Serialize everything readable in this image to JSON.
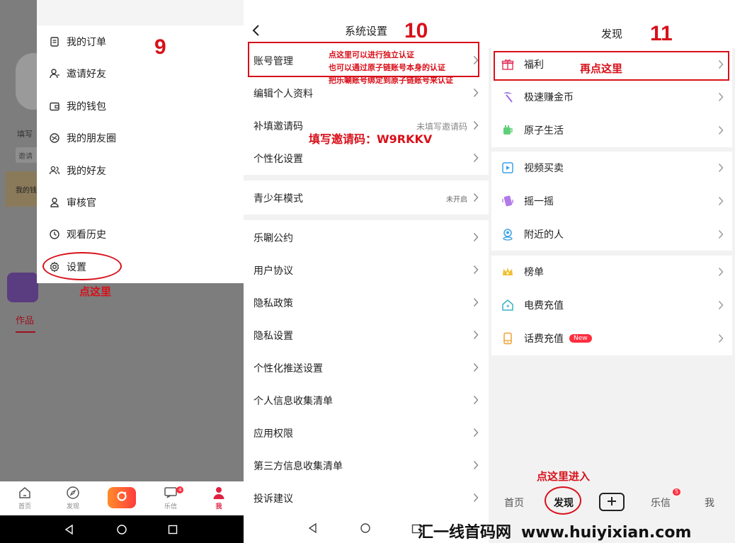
{
  "panel1": {
    "background": {
      "fill_label": "填写",
      "tag_label": "邀请",
      "wallet_label": "我的钱",
      "tab_label": "作品"
    },
    "menu": [
      {
        "label": "我的订单",
        "icon": "order-icon"
      },
      {
        "label": "邀请好友",
        "icon": "invite-user-icon"
      },
      {
        "label": "我的钱包",
        "icon": "wallet-icon"
      },
      {
        "label": "我的朋友圈",
        "icon": "moments-icon"
      },
      {
        "label": "我的好友",
        "icon": "friends-icon"
      },
      {
        "label": "审核官",
        "icon": "reviewer-icon"
      },
      {
        "label": "观看历史",
        "icon": "history-icon"
      },
      {
        "label": "设置",
        "icon": "gear-icon"
      }
    ],
    "tabbar": [
      {
        "label": "首页",
        "icon": "home-icon"
      },
      {
        "label": "发现",
        "icon": "compass-icon"
      },
      {
        "label": "",
        "icon": "camera-icon"
      },
      {
        "label": "乐信",
        "icon": "message-icon",
        "badge": "4"
      },
      {
        "label": "我",
        "icon": "user-icon"
      }
    ],
    "annotation_step": "9",
    "annotation_text": "点这里"
  },
  "panel2": {
    "title": "系统设置",
    "rows": [
      {
        "label": "账号管理",
        "right": ""
      },
      {
        "label": "编辑个人资料",
        "right": ""
      },
      {
        "label": "补填邀请码",
        "right": "未填写邀请码"
      },
      {
        "label": "个性化设置",
        "right": ""
      },
      {
        "label": "青少年模式",
        "right": "未开启"
      },
      {
        "label": "乐唰公约",
        "right": ""
      },
      {
        "label": "用户协议",
        "right": ""
      },
      {
        "label": "隐私政策",
        "right": ""
      },
      {
        "label": "隐私设置",
        "right": ""
      },
      {
        "label": "个性化推送设置",
        "right": ""
      },
      {
        "label": "个人信息收集清单",
        "right": ""
      },
      {
        "label": "应用权限",
        "right": ""
      },
      {
        "label": "第三方信息收集清单",
        "right": ""
      },
      {
        "label": "投诉建议",
        "right": ""
      }
    ],
    "annotation_step": "10",
    "annotation_lines": [
      "点这里可以进行独立认证",
      "也可以通过原子链账号本身的认证",
      "把乐唰账号绑定到原子链账号来认证"
    ],
    "annotation_code": "填写邀请码：W9RKKV"
  },
  "panel3": {
    "title": "发现",
    "groups": [
      [
        {
          "label": "福利",
          "icon": "gift-icon"
        },
        {
          "label": "极速赚金币",
          "icon": "pickaxe-icon"
        },
        {
          "label": "原子生活",
          "icon": "cup-icon"
        }
      ],
      [
        {
          "label": "视频买卖",
          "icon": "video-icon"
        },
        {
          "label": "摇一摇",
          "icon": "shake-icon"
        },
        {
          "label": "附近的人",
          "icon": "location-user-icon"
        }
      ],
      [
        {
          "label": "榜单",
          "icon": "crown-icon"
        },
        {
          "label": "电费充值",
          "icon": "house-bolt-icon"
        },
        {
          "label": "话费充值",
          "icon": "phone-icon",
          "badge": "New"
        }
      ]
    ],
    "tabbar": [
      {
        "label": "首页"
      },
      {
        "label": "发现"
      },
      {
        "label": "",
        "icon": "plus-icon"
      },
      {
        "label": "乐信",
        "badge": "5"
      },
      {
        "label": "我"
      }
    ],
    "annotation_step": "11",
    "annotation_text_top": "再点这里",
    "annotation_text_bottom": "点这里进入"
  },
  "watermark": {
    "cn": "汇一线首码网",
    "url": "www.huiyixian.com"
  },
  "colors": {
    "accent": "#d8101a",
    "badge": "#ff2d3d",
    "active_tab": "#e02040"
  }
}
